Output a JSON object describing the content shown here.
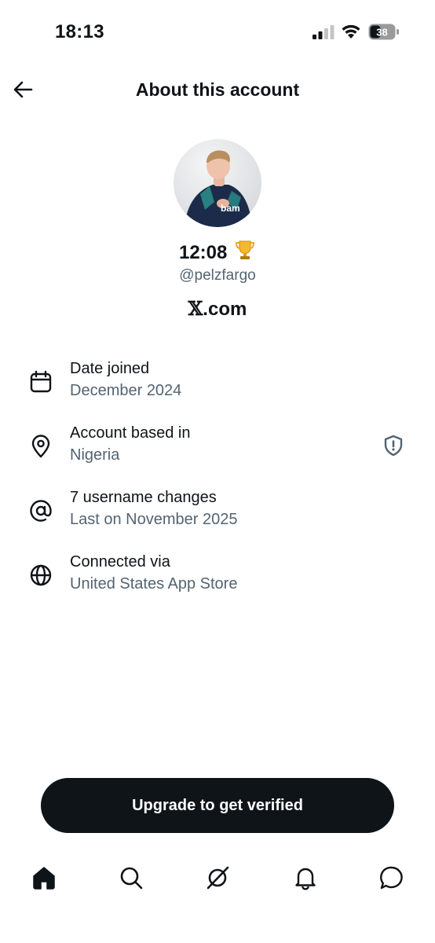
{
  "status_bar": {
    "time": "18:13",
    "battery_level": "38"
  },
  "header": {
    "title": "About this account",
    "back_icon": "arrow-left-icon"
  },
  "profile": {
    "display_name": "12:08",
    "name_emoji": "trophy-icon",
    "handle": "@pelzfargo",
    "site_mark": "𝕏",
    "site_suffix": ".com",
    "avatar_text": "bam"
  },
  "rows": [
    {
      "icon": "calendar-icon",
      "title": "Date joined",
      "subtitle": "December 2024"
    },
    {
      "icon": "location-pin-icon",
      "title": "Account based in",
      "subtitle": "Nigeria",
      "trailing_icon": "shield-alert-icon"
    },
    {
      "icon": "at-sign-icon",
      "title": "7 username changes",
      "subtitle": "Last on November 2025"
    },
    {
      "icon": "globe-icon",
      "title": "Connected via",
      "subtitle": "United States App Store"
    }
  ],
  "cta": {
    "label": "Upgrade to get verified"
  },
  "bottom_nav": [
    {
      "icon": "home-icon",
      "active": true
    },
    {
      "icon": "search-icon",
      "active": false
    },
    {
      "icon": "grok-icon",
      "active": false
    },
    {
      "icon": "bell-icon",
      "active": false
    },
    {
      "icon": "messages-icon",
      "active": false
    }
  ],
  "colors": {
    "text": "#0f1419",
    "secondary": "#536471",
    "button_bg": "#0f1419",
    "background": "#ffffff"
  }
}
